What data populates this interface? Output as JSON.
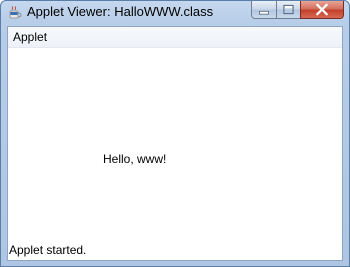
{
  "window": {
    "title": "Applet Viewer: HalloWWW.class",
    "buttons": {
      "minimize_icon": "minimize-icon",
      "maximize_icon": "maximize-icon",
      "close_icon": "close-icon"
    },
    "colors": {
      "titlebar": "#b7cde8",
      "close_button": "#c4402b"
    }
  },
  "menubar": {
    "items": [
      {
        "label": "Applet"
      }
    ]
  },
  "applet": {
    "message": "Hello, www!"
  },
  "status": {
    "text": "Applet started."
  }
}
